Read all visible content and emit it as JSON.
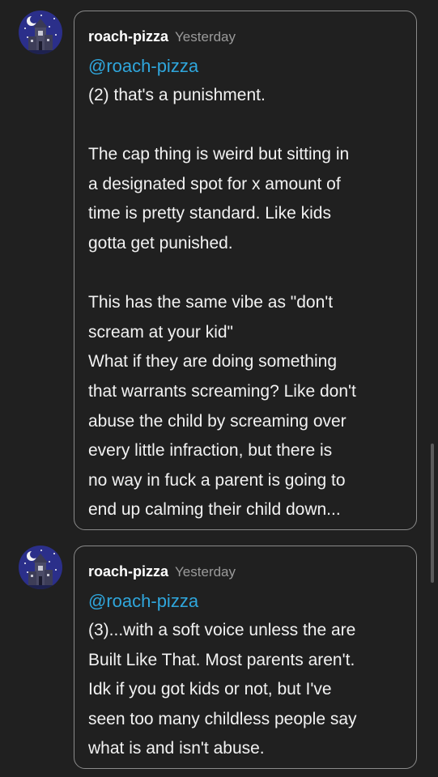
{
  "replies": [
    {
      "username": "roach-pizza",
      "timestamp": "Yesterday",
      "mention": "@roach-pizza",
      "body": "(2) that's a punishment.\n\nThe cap thing is weird but sitting in\na designated spot for x amount of\ntime is pretty standard. Like kids\ngotta get punished.\n\nThis has the same vibe as \"don't\nscream at your kid\"\nWhat if they are doing something\nthat warrants screaming? Like don't\nabuse the child by screaming over\nevery little infraction, but there is\nno way in fuck a parent is going to\nend up calming their child down...",
      "avatar_icon": "haunted-house-night-icon"
    },
    {
      "username": "roach-pizza",
      "timestamp": "Yesterday",
      "mention": "@roach-pizza",
      "body": "(3)...with a soft voice unless the are\nBuilt Like That. Most parents aren't.\nIdk if you got kids or not, but I've\nseen too many childless people say\nwhat is and isn't abuse.",
      "avatar_icon": "haunted-house-night-icon"
    }
  ],
  "colors": {
    "background": "#202020",
    "text": "#f2f2f2",
    "mention": "#2fa6dc",
    "timestamp": "#9a9a9a",
    "bubble_border": "#8a8a8a",
    "avatar_sky": "#2b2f8a"
  }
}
